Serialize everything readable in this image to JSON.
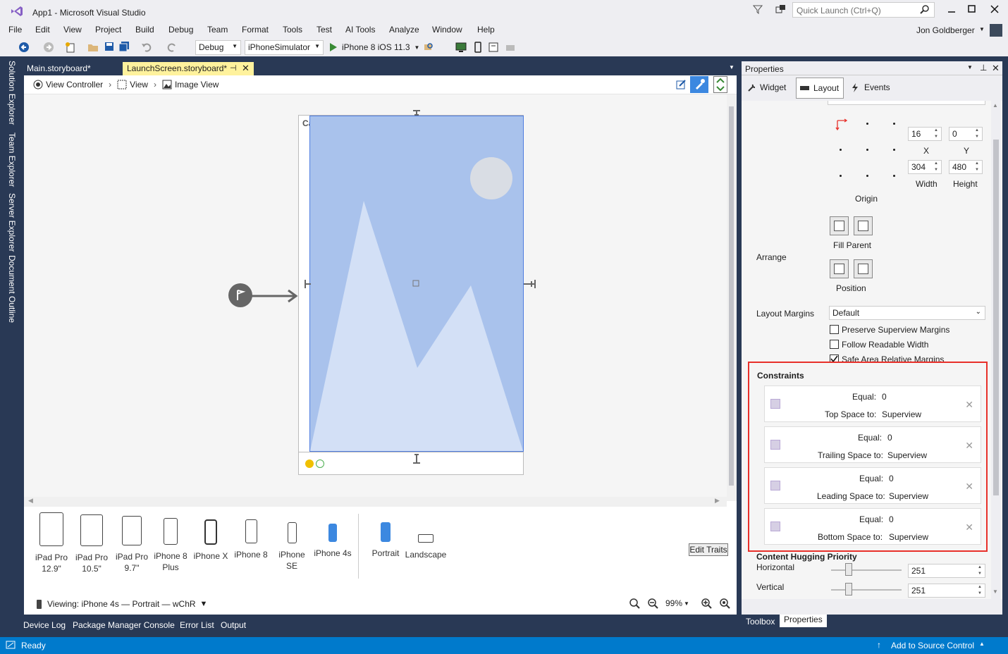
{
  "window": {
    "title": "App1 - Microsoft Visual Studio",
    "quick_launch_placeholder": "Quick Launch (Ctrl+Q)",
    "user": "Jon Goldberger"
  },
  "menu": [
    "File",
    "Edit",
    "View",
    "Project",
    "Build",
    "Debug",
    "Team",
    "Format",
    "Tools",
    "Test",
    "AI Tools",
    "Analyze",
    "Window",
    "Help"
  ],
  "toolbar": {
    "config": "Debug",
    "platform": "iPhoneSimulator",
    "run_target": "iPhone 8 iOS 11.3"
  },
  "side_tabs": [
    "Solution Explorer",
    "Team Explorer",
    "Server Explorer",
    "Document Outline"
  ],
  "doc_tabs": [
    {
      "label": "Main.storyboard*",
      "active": false
    },
    {
      "label": "LaunchScreen.storyboard*",
      "active": true
    }
  ],
  "breadcrumb": [
    "View Controller",
    "View",
    "Image View"
  ],
  "canvas": {
    "status_carrier": "Carrier"
  },
  "devices": [
    {
      "label": "iPad Pro",
      "sub": "12.9\""
    },
    {
      "label": "iPad Pro",
      "sub": "10.5\""
    },
    {
      "label": "iPad Pro",
      "sub": "9.7\""
    },
    {
      "label": "iPhone 8",
      "sub": "Plus"
    },
    {
      "label": "iPhone X",
      "sub": ""
    },
    {
      "label": "iPhone 8",
      "sub": ""
    },
    {
      "label": "iPhone SE",
      "sub": ""
    },
    {
      "label": "iPhone 4s",
      "sub": ""
    }
  ],
  "orientations": [
    "Portrait",
    "Landscape"
  ],
  "edit_traits": "Edit Traits",
  "viewing": "Viewing: iPhone 4s — Portrait — wChR",
  "zoom": "99%",
  "bottom_tabs": [
    "Device Log",
    "Package Manager Console",
    "Error List",
    "Output"
  ],
  "status": {
    "ready": "Ready",
    "source_control": "Add to Source Control"
  },
  "properties": {
    "title": "Properties",
    "tabs": [
      "Widget",
      "Layout",
      "Events"
    ],
    "x": "16",
    "y": "0",
    "width": "304",
    "height": "480",
    "x_label": "X",
    "y_label": "Y",
    "width_label": "Width",
    "height_label": "Height",
    "origin": "Origin",
    "arrange": "Arrange",
    "fill_parent": "Fill Parent",
    "position": "Position",
    "layout_margins_label": "Layout Margins",
    "layout_margins_value": "Default",
    "checkboxes": [
      {
        "label": "Preserve Superview Margins",
        "checked": false
      },
      {
        "label": "Follow Readable Width",
        "checked": false
      },
      {
        "label": "Safe Area Relative Margins",
        "checked": true
      }
    ],
    "constraints_title": "Constraints",
    "constraints": [
      {
        "eq": "Equal:",
        "val": "0",
        "desc": "Top Space to:",
        "target": "Superview"
      },
      {
        "eq": "Equal:",
        "val": "0",
        "desc": "Trailing Space to:",
        "target": "Superview"
      },
      {
        "eq": "Equal:",
        "val": "0",
        "desc": "Leading Space to:",
        "target": "Superview"
      },
      {
        "eq": "Equal:",
        "val": "0",
        "desc": "Bottom Space to:",
        "target": "Superview"
      }
    ],
    "hugging_title": "Content Hugging Priority",
    "horizontal": "Horizontal",
    "vertical": "Vertical",
    "horizontal_value": "251",
    "vertical_value": "251"
  },
  "panel_tabs": [
    "Toolbox",
    "Properties"
  ],
  "colors": {
    "vs_blue": "#007acc",
    "dark_bg": "#293955",
    "highlight": "#e8302a",
    "image_blue": "#a9c2ec",
    "tab_yellow": "#fff29d"
  }
}
